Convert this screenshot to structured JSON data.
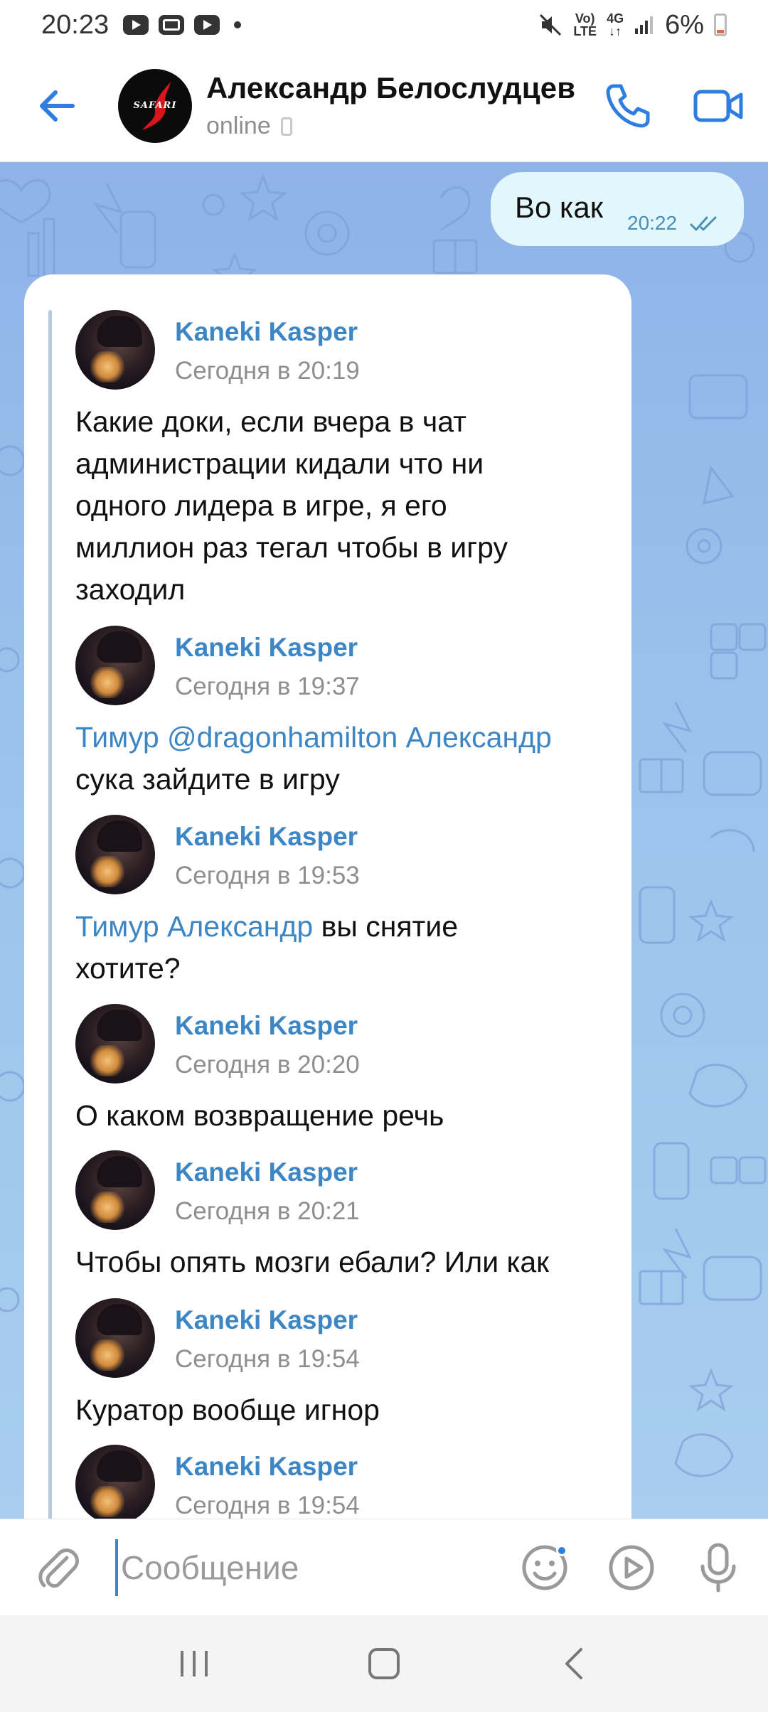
{
  "status_bar": {
    "time": "20:23",
    "network_top": "Vo)",
    "network_bottom": "LTE",
    "signal_label": "4G",
    "battery": "6%"
  },
  "header": {
    "title": "Александр Белослудцев",
    "status": "online",
    "avatar_text": "SAFARI",
    "back_icon": "arrow-left-icon",
    "call_icon": "phone-icon",
    "video_icon": "video-icon"
  },
  "outgoing_message": {
    "text": "Во как",
    "time": "20:22",
    "status_icon": "double-check-icon"
  },
  "forwarded_messages": [
    {
      "author": "Kaneki Kasper",
      "date": "Сегодня в 20:19",
      "text": "Какие доки, если вчера в чат\nадминистрации кидали что ни\nодного лидера в игре, я его\nмиллион раз тегал чтобы в игру\nзаходил"
    },
    {
      "author": "Kaneki Kasper",
      "date": "Сегодня в 19:37",
      "mention": "Тимур @dragonhamilton Александр",
      "text": "\nсука зайдите в игру"
    },
    {
      "author": "Kaneki Kasper",
      "date": "Сегодня в 19:53",
      "mention": "Тимур Александр",
      "text": " вы снятие\nхотите?"
    },
    {
      "author": "Kaneki Kasper",
      "date": "Сегодня в 20:20",
      "text": "О каком возвращение речь"
    },
    {
      "author": "Kaneki Kasper",
      "date": "Сегодня в 20:21",
      "text": "Чтобы опять мозги ебали? Или как"
    },
    {
      "author": "Kaneki Kasper",
      "date": "Сегодня в 19:54",
      "text": "Куратор вообще игнор"
    },
    {
      "author": "Kaneki Kasper",
      "date": "Сегодня в 19:54",
      "text": ""
    }
  ],
  "input": {
    "placeholder": "Сообщение",
    "value": ""
  },
  "colors": {
    "accent": "#3d86c6",
    "outgoing_bubble": "#e2f7fb",
    "chat_background": "#9cc3ec"
  }
}
